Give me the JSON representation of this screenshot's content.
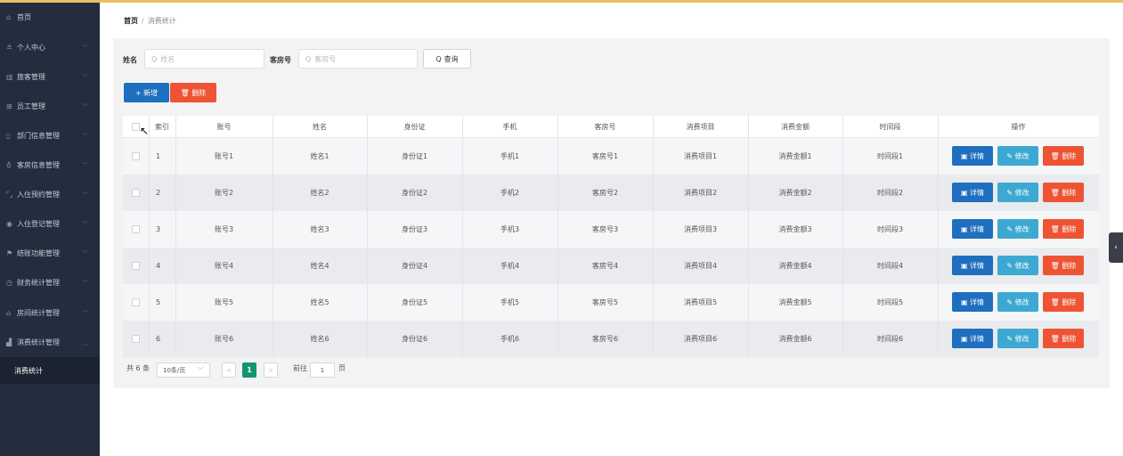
{
  "sidebar": {
    "items": [
      {
        "label": "首页",
        "icon": "home-icon",
        "glyph": "⌂",
        "chev": ""
      },
      {
        "label": "个人中心",
        "icon": "user-icon",
        "glyph": "≗",
        "chev": "﹀"
      },
      {
        "label": "旅客管理",
        "icon": "bar-chart-icon",
        "glyph": "▥",
        "chev": "﹀"
      },
      {
        "label": "员工管理",
        "icon": "grid-icon",
        "glyph": "⊞",
        "chev": "﹀"
      },
      {
        "label": "部门信息管理",
        "icon": "phone-icon",
        "glyph": "▯",
        "chev": "﹀"
      },
      {
        "label": "客房信息管理",
        "icon": "mic-icon",
        "glyph": "♁",
        "chev": "﹀"
      },
      {
        "label": "入住预约管理",
        "icon": "frame-icon",
        "glyph": "⌜⌟",
        "chev": "﹀"
      },
      {
        "label": "入住登记管理",
        "icon": "location-icon",
        "glyph": "◉",
        "chev": "﹀"
      },
      {
        "label": "结账功能管理",
        "icon": "flag-icon",
        "glyph": "⚑",
        "chev": "﹀"
      },
      {
        "label": "财务统计管理",
        "icon": "clock-icon",
        "glyph": "◷",
        "chev": "﹀"
      },
      {
        "label": "房间统计管理",
        "icon": "building-icon",
        "glyph": "⌂",
        "chev": "﹀"
      },
      {
        "label": "消费统计管理",
        "icon": "chart-icon",
        "glyph": "▟",
        "chev": "︿"
      }
    ],
    "sub_item": "消费统计"
  },
  "breadcrumb": {
    "home": "首页",
    "sep": "/",
    "current": "消费统计"
  },
  "search": {
    "name_label": "姓名",
    "name_placeholder": "姓名",
    "room_label": "客房号",
    "room_placeholder": "客房号",
    "query_label": "查询",
    "mag": "Q"
  },
  "actions": {
    "add_label": "+ 新增",
    "delete_label": "🗑 删除"
  },
  "table": {
    "headers": [
      "索引",
      "账号",
      "姓名",
      "身份证",
      "手机",
      "客房号",
      "消费项目",
      "消费金额",
      "时间段",
      "操作"
    ],
    "rows": [
      [
        "1",
        "账号1",
        "姓名1",
        "身份证1",
        "手机1",
        "客房号1",
        "消费项目1",
        "消费金额1",
        "时间段1"
      ],
      [
        "2",
        "账号2",
        "姓名2",
        "身份证2",
        "手机2",
        "客房号2",
        "消费项目2",
        "消费金额2",
        "时间段2"
      ],
      [
        "3",
        "账号3",
        "姓名3",
        "身份证3",
        "手机3",
        "客房号3",
        "消费项目3",
        "消费金额3",
        "时间段3"
      ],
      [
        "4",
        "账号4",
        "姓名4",
        "身份证4",
        "手机4",
        "客房号4",
        "消费项目4",
        "消费金额4",
        "时间段4"
      ],
      [
        "5",
        "账号5",
        "姓名5",
        "身份证5",
        "手机5",
        "客房号5",
        "消费项目5",
        "消费金额5",
        "时间段5"
      ],
      [
        "6",
        "账号6",
        "姓名6",
        "身份证6",
        "手机6",
        "客房号6",
        "消费项目6",
        "消费金额6",
        "时间段6"
      ]
    ],
    "row_actions": {
      "detail": "▣ 详情",
      "edit": "✎ 修改",
      "delete": "🗑 删除"
    }
  },
  "pagination": {
    "total": "共 6 条",
    "page_size": "10条/页",
    "prev": "<",
    "current_page": "1",
    "next": ">",
    "goto_label": "前往",
    "goto_value": "1",
    "page_unit": "页"
  },
  "right_tab": {
    "glyph": "‹"
  },
  "colors": {
    "sidebar": "#232d3e",
    "primary": "#1e6fbf",
    "danger": "#ee5434",
    "info": "#3da9d2",
    "page_active": "#12966f"
  }
}
